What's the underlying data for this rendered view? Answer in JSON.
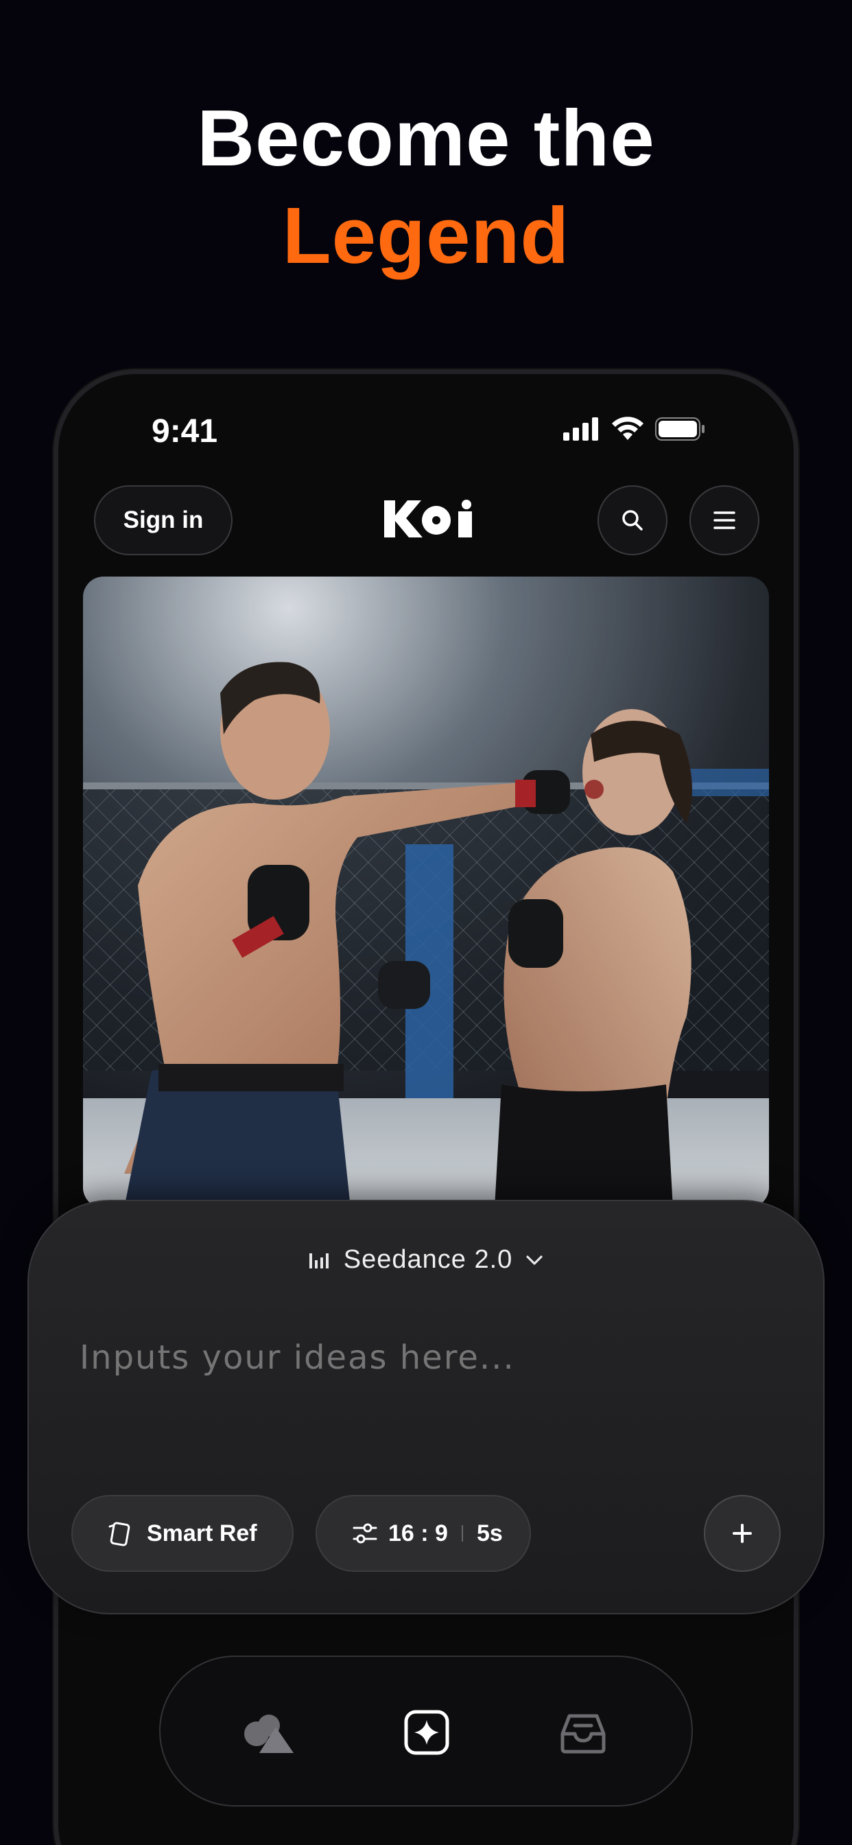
{
  "headline": {
    "line1": "Become the",
    "line2": "Legend"
  },
  "status_bar": {
    "time": "9:41"
  },
  "header": {
    "sign_in": "Sign in",
    "logo_text": "KOi"
  },
  "composer": {
    "model_name": "Seedance 2.0",
    "prompt_placeholder": "Inputs your ideas here...",
    "smart_ref_label": "Smart Ref",
    "aspect_ratio": "16 : 9",
    "duration": "5s"
  },
  "tabs": [
    "shapes-icon",
    "sparkle-icon",
    "inbox-icon"
  ],
  "colors": {
    "accent": "#ff6a10",
    "background": "#05040d"
  }
}
